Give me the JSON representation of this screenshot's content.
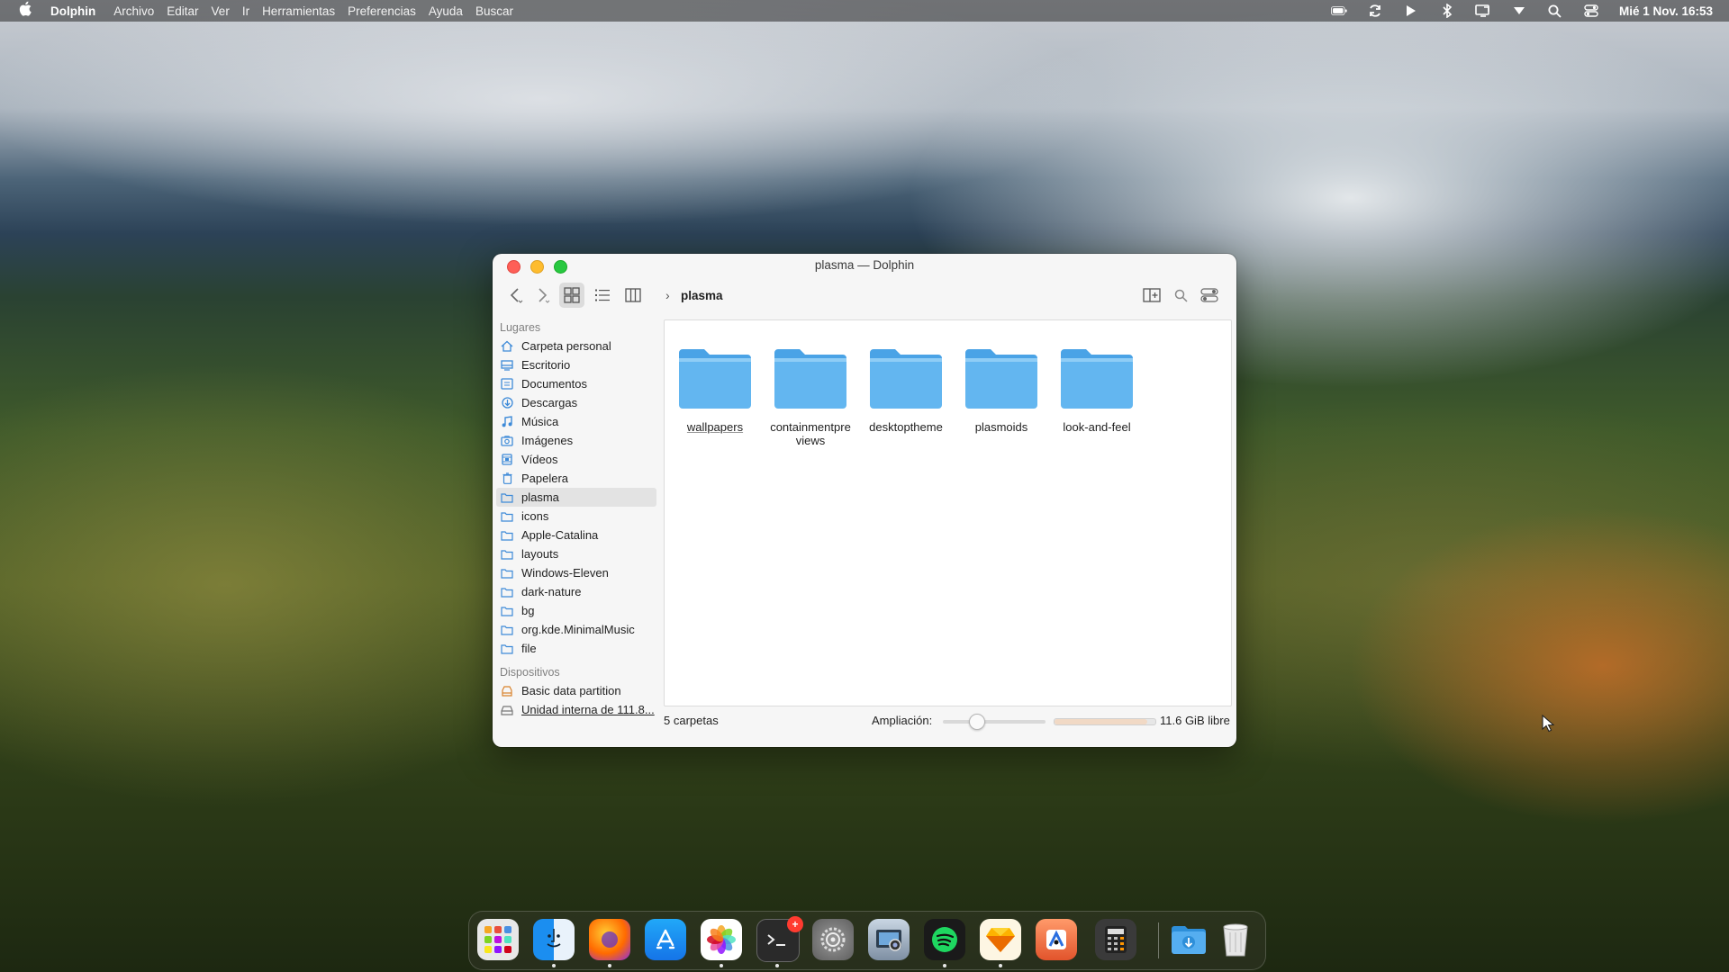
{
  "menubar": {
    "app_name": "Dolphin",
    "items": [
      "Archivo",
      "Editar",
      "Ver",
      "Ir",
      "Herramientas",
      "Preferencias",
      "Ayuda",
      "Buscar"
    ],
    "clock": "Mié 1 Nov. 16:53"
  },
  "window": {
    "title": "plasma — Dolphin",
    "breadcrumb": "plasma",
    "sidebar": {
      "places_header": "Lugares",
      "places": [
        {
          "label": "Carpeta personal",
          "icon": "home-icon"
        },
        {
          "label": "Escritorio",
          "icon": "desktop-icon"
        },
        {
          "label": "Documentos",
          "icon": "documents-icon"
        },
        {
          "label": "Descargas",
          "icon": "downloads-icon"
        },
        {
          "label": "Música",
          "icon": "music-icon"
        },
        {
          "label": "Imágenes",
          "icon": "pictures-icon"
        },
        {
          "label": "Vídeos",
          "icon": "videos-icon"
        },
        {
          "label": "Papelera",
          "icon": "trash-icon"
        },
        {
          "label": "plasma",
          "icon": "folder-icon"
        },
        {
          "label": "icons",
          "icon": "folder-icon"
        },
        {
          "label": "Apple-Catalina",
          "icon": "folder-icon"
        },
        {
          "label": "layouts",
          "icon": "folder-icon"
        },
        {
          "label": "Windows-Eleven",
          "icon": "folder-icon"
        },
        {
          "label": "dark-nature",
          "icon": "folder-icon"
        },
        {
          "label": "bg",
          "icon": "folder-icon"
        },
        {
          "label": "org.kde.MinimalMusic",
          "icon": "folder-icon"
        },
        {
          "label": "file",
          "icon": "folder-icon"
        }
      ],
      "selected_place": "plasma",
      "devices_header": "Dispositivos",
      "devices": [
        {
          "label": "Basic data partition",
          "icon": "drive-icon"
        },
        {
          "label": "Unidad interna de 111.8...",
          "icon": "hard-disk-icon"
        }
      ]
    },
    "files": [
      {
        "label": "wallpapers"
      },
      {
        "label": "containmentpre\nviews"
      },
      {
        "label": "desktoptheme"
      },
      {
        "label": "plasmoids"
      },
      {
        "label": "look-and-feel"
      }
    ],
    "status": {
      "count": "5 carpetas",
      "zoom_label": "Ampliación:",
      "zoom_level": 0.3,
      "free_space": "11.6 GiB libre",
      "used_fraction": 0.92
    }
  },
  "dock": {
    "apps": [
      {
        "name": "launchpad",
        "running": false
      },
      {
        "name": "finder",
        "running": true
      },
      {
        "name": "firefox",
        "running": true
      },
      {
        "name": "app-store",
        "running": false
      },
      {
        "name": "photos",
        "running": true
      },
      {
        "name": "terminal",
        "running": true,
        "badge": "+"
      },
      {
        "name": "system-settings",
        "running": false
      },
      {
        "name": "screenshot",
        "running": false
      },
      {
        "name": "spotify",
        "running": true
      },
      {
        "name": "sketch",
        "running": true
      },
      {
        "name": "vpn-tool",
        "running": false
      },
      {
        "name": "calculator",
        "running": false
      },
      {
        "name": "downloads-folder",
        "running": false
      },
      {
        "name": "trash",
        "running": false
      }
    ]
  },
  "colors": {
    "folder": "#5fb3ee",
    "close": "#fe5f57",
    "minimize": "#febc2e",
    "maximize": "#28c840"
  }
}
